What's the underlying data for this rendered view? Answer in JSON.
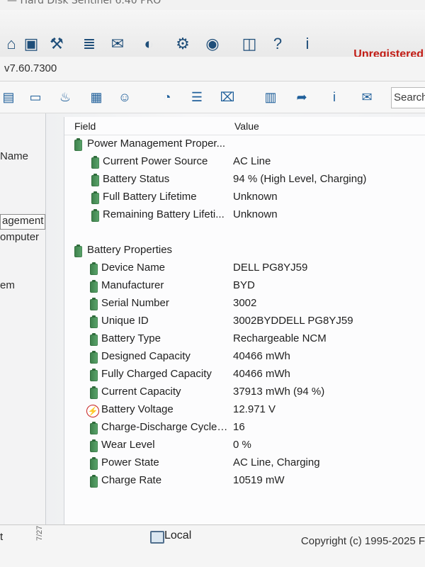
{
  "window": {
    "title_fragment": "— Hard Disk Sentinel 6.40 PRO",
    "version": "v7.60.7300",
    "unregistered": "Unregistered"
  },
  "toolbar_top": {
    "icons": [
      "drive-icon",
      "network-icon",
      "tools-icon",
      "report-icon",
      "mail-icon",
      "globe-icon",
      "settings-icon",
      "speaker-icon",
      "camera-icon",
      "help-icon",
      "info-icon"
    ]
  },
  "toolbar_second": {
    "icons": [
      "device-icon",
      "monitor-icon",
      "fire-icon",
      "calendar-icon",
      "user-icon",
      "time-icon",
      "stack-icon",
      "calculator-icon",
      "report-icon",
      "forward-icon",
      "info-icon",
      "folder-icon"
    ],
    "search_label": "Search"
  },
  "sidebar": {
    "items": [
      {
        "label": "Name"
      },
      {
        "label": "agement"
      },
      {
        "label": "omputer"
      },
      {
        "label": "em"
      },
      {
        "label": "t"
      }
    ]
  },
  "table": {
    "headers": [
      "Field",
      "Value"
    ],
    "power_group": "Power Management Proper...",
    "power_rows": [
      {
        "field": "Current Power Source",
        "value": "AC Line"
      },
      {
        "field": "Battery Status",
        "value": "94 % (High Level, Charging)"
      },
      {
        "field": "Full Battery Lifetime",
        "value": "Unknown"
      },
      {
        "field": "Remaining Battery Lifeti...",
        "value": "Unknown"
      }
    ],
    "battery_group": "Battery Properties",
    "battery_rows": [
      {
        "field": "Device Name",
        "value": "DELL PG8YJ59"
      },
      {
        "field": "Manufacturer",
        "value": "BYD"
      },
      {
        "field": "Serial Number",
        "value": "3002"
      },
      {
        "field": "Unique ID",
        "value": "3002BYDDELL PG8YJ59"
      },
      {
        "field": "Battery Type",
        "value": "Rechargeable NCM"
      },
      {
        "field": "Designed Capacity",
        "value": "40466 mWh"
      },
      {
        "field": "Fully Charged Capacity",
        "value": "40466 mWh"
      },
      {
        "field": "Current Capacity",
        "value": "37913 mWh  (94 %)"
      },
      {
        "field": "Battery Voltage",
        "value": "12.971 V"
      },
      {
        "field": "Charge-Discharge Cycle ...",
        "value": "16"
      },
      {
        "field": "Wear Level",
        "value": "0 %"
      },
      {
        "field": "Power State",
        "value": "AC Line, Charging"
      },
      {
        "field": "Charge Rate",
        "value": "10519 mW"
      }
    ]
  },
  "status_bar": {
    "left_text": "t",
    "local_label": "Local",
    "copyright": "Copyright (c) 1995-2025 F",
    "side_date": "7/27"
  }
}
